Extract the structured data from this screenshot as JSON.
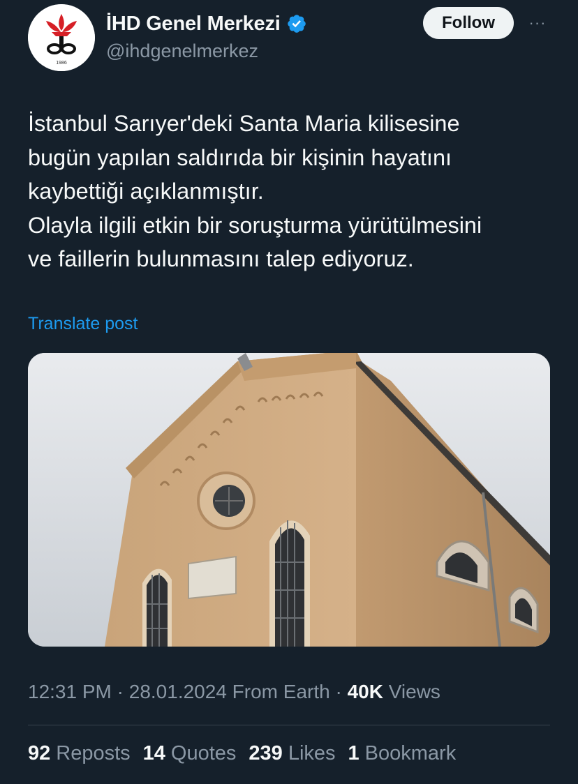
{
  "account": {
    "display_name": "İHD Genel Merkezi",
    "handle": "@ihdgenelmerkez",
    "avatar_year": "1986",
    "verified": true,
    "verified_color": "#1d9bf0"
  },
  "actions": {
    "follow_label": "Follow",
    "more_label": "···"
  },
  "tweet": {
    "text": "İstanbul Sarıyer'deki Santa Maria kilisesine\nbugün yapılan saldırıda bir kişinin hayatını\nkaybettiği açıklanmıştır.\nOlayla ilgili etkin bir soruşturma yürütülmesini\nve faillerin bulunmasını talep ediyoruz.",
    "translate_label": "Translate post"
  },
  "meta": {
    "time": "12:31 PM",
    "date": "28.01.2024",
    "source": "From Earth",
    "views_count": "40K",
    "views_label": "Views",
    "separator": "·"
  },
  "stats": {
    "reposts_count": "92",
    "reposts_label": "Reposts",
    "quotes_count": "14",
    "quotes_label": "Quotes",
    "likes_count": "239",
    "likes_label": "Likes",
    "bookmarks_count": "1",
    "bookmarks_label": "Bookmark"
  },
  "colors": {
    "background": "#15202b",
    "text_primary": "#f7f9f9",
    "text_secondary": "#8b98a5",
    "link": "#1d9bf0",
    "divider": "#38444d"
  }
}
